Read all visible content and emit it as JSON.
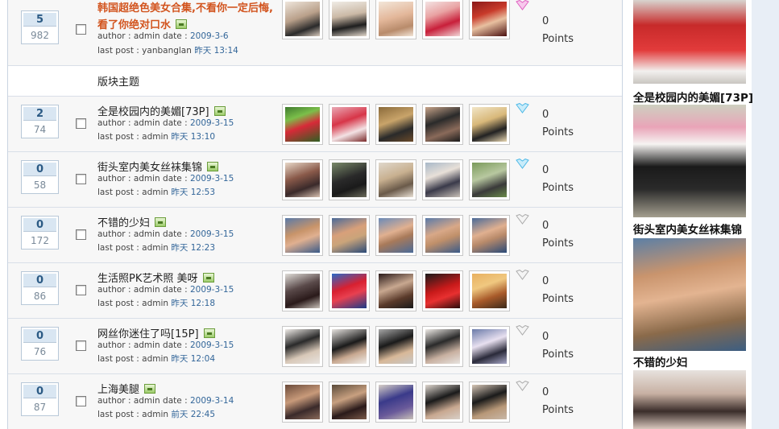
{
  "sticky_thread": {
    "replies": "5",
    "views": "982",
    "title": "韩国超绝色美女合集,不看你一定后悔,看了你绝对口水",
    "author_prefix": "author : admin date : ",
    "date": "2009-3-6",
    "last_prefix": "last post : yanbanglan ",
    "last_time": "昨天 13:14",
    "points": "0",
    "points_label": "Points",
    "heart_color": "#e060c0"
  },
  "section": {
    "label": "版块主题"
  },
  "threads": [
    {
      "replies": "2",
      "views": "74",
      "title": "全是校园内的美媚[73P]",
      "author_prefix": "author : admin date : ",
      "date": "2009-3-15",
      "last_prefix": "last post : admin ",
      "last_time": "昨天 13:10",
      "points": "0",
      "points_label": "Points",
      "heart_color": "#4cb8e6"
    },
    {
      "replies": "0",
      "views": "58",
      "title": "街头室内美女丝袜集锦",
      "author_prefix": "author : admin date : ",
      "date": "2009-3-15",
      "last_prefix": "last post : admin ",
      "last_time": "昨天 12:53",
      "points": "0",
      "points_label": "Points",
      "heart_color": "#4cb8e6"
    },
    {
      "replies": "0",
      "views": "172",
      "title": "不错的少妇",
      "author_prefix": "author : admin date : ",
      "date": "2009-3-15",
      "last_prefix": "last post : admin ",
      "last_time": "昨天 12:23",
      "points": "0",
      "points_label": "Points",
      "heart_color": "#aaaaaa"
    },
    {
      "replies": "0",
      "views": "86",
      "title": "生活照PK艺术照  美呀",
      "author_prefix": "author : admin date : ",
      "date": "2009-3-15",
      "last_prefix": "last post : admin ",
      "last_time": "昨天 12:18",
      "points": "0",
      "points_label": "Points",
      "heart_color": "#aaaaaa"
    },
    {
      "replies": "0",
      "views": "76",
      "title": "网丝你迷住了吗[15P]",
      "author_prefix": "author : admin date : ",
      "date": "2009-3-15",
      "last_prefix": "last post : admin ",
      "last_time": "昨天 12:04",
      "points": "0",
      "points_label": "Points",
      "heart_color": "#aaaaaa"
    },
    {
      "replies": "0",
      "views": "87",
      "title": "上海美腿",
      "author_prefix": "author : admin date : ",
      "date": "2009-3-14",
      "last_prefix": "last post : admin ",
      "last_time": "前天 22:45",
      "points": "0",
      "points_label": "Points",
      "heart_color": "#aaaaaa"
    }
  ],
  "sidebar": {
    "captions": [
      "全是校园内的美媚[73P]",
      "街头室内美女丝袜集锦",
      "不错的少妇"
    ]
  },
  "colors": {
    "hot_title": "#d2541e",
    "link_blue": "#336699"
  },
  "icons": {
    "attachment": "image-attachment-icon",
    "rating": "heart-icon",
    "select": "checkbox"
  }
}
